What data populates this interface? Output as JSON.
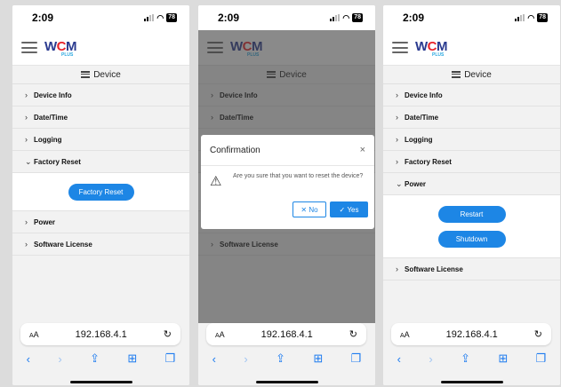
{
  "status": {
    "time": "2:09",
    "battery": "78"
  },
  "brand": {
    "logo_main_1": "W",
    "logo_main_2": "C",
    "logo_main_3": "M",
    "logo_sub": "PLUS"
  },
  "section_title": "Device",
  "menu": {
    "device_info": "Device Info",
    "date_time": "Date/Time",
    "logging": "Logging",
    "factory_reset": "Factory Reset",
    "power": "Power",
    "software_license": "Software License"
  },
  "actions": {
    "factory_reset": "Factory Reset",
    "restart": "Restart",
    "shutdown": "Shutdown"
  },
  "dialog": {
    "title": "Confirmation",
    "message": "Are you sure that you want to reset the device?",
    "no": "No",
    "yes": "Yes"
  },
  "browser": {
    "text_size_label_small": "A",
    "text_size_label_large": "A",
    "url": "192.168.4.1"
  },
  "icons": {
    "accent": "#1d86e5",
    "nav_color": "#1d7bf0"
  }
}
